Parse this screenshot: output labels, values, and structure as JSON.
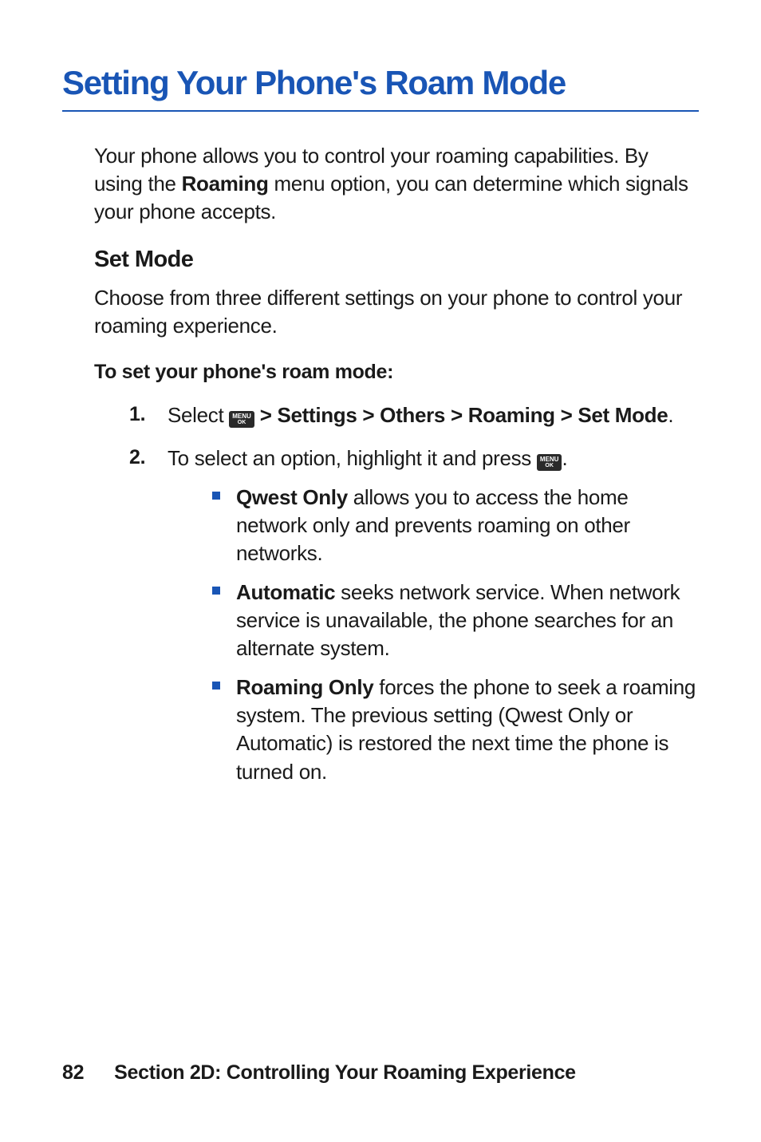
{
  "title": "Setting Your Phone's Roam Mode",
  "intro": {
    "before": "Your phone allows you to control your roaming capabilities. By using the ",
    "bold": "Roaming",
    "after": " menu option, you can determine which signals your phone accepts."
  },
  "subhead": "Set Mode",
  "para": "Choose from three different settings on your phone to control your roaming experience.",
  "instr": "To set your phone's roam mode:",
  "menu_icon": {
    "line1": "MENU",
    "line2": "OK"
  },
  "steps": {
    "s1": {
      "num": "1.",
      "before": "Select ",
      "bold": " > Settings > Others > Roaming > Set Mode",
      "after": "."
    },
    "s2": {
      "num": "2.",
      "before": "To select an option, highlight it and press ",
      "after": "."
    }
  },
  "bullets": {
    "b1": {
      "bold": "Qwest Only",
      "text": " allows you to access the home network only and prevents roaming on other networks."
    },
    "b2": {
      "bold": "Automatic",
      "text": " seeks network service. When network service is unavailable, the phone searches for an alternate system."
    },
    "b3": {
      "bold": "Roaming Only",
      "text": " forces the phone to seek a roaming system. The previous setting (Qwest Only or Automatic) is restored the next time the phone is turned on."
    }
  },
  "footer": {
    "page": "82",
    "section": "Section 2D: Controlling Your Roaming Experience"
  }
}
